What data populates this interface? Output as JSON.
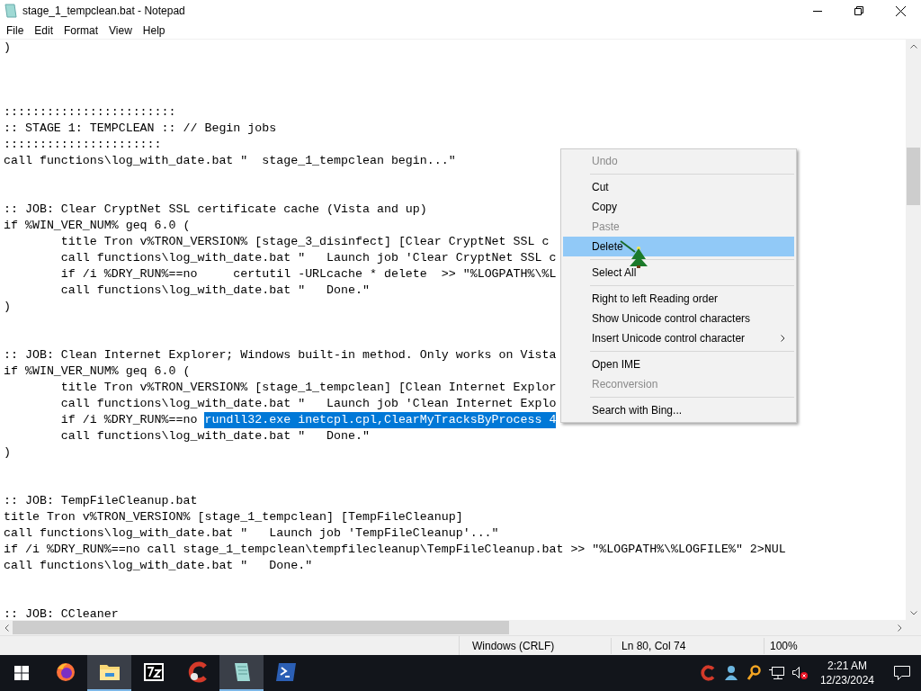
{
  "window": {
    "title": "stage_1_tempclean.bat - Notepad"
  },
  "menu_bar": [
    "File",
    "Edit",
    "Format",
    "View",
    "Help"
  ],
  "editor": {
    "lines": [
      {
        "kind": "code",
        "text": ")"
      },
      {
        "kind": "blank"
      },
      {
        "kind": "blank"
      },
      {
        "kind": "blank"
      },
      {
        "kind": "code",
        "text": "::::::::::::::::::::::::"
      },
      {
        "kind": "code",
        "text": ":: STAGE 1: TEMPCLEAN :: // Begin jobs"
      },
      {
        "kind": "code",
        "text": "::::::::::::::::::::::"
      },
      {
        "kind": "code",
        "text": "call functions\\log_with_date.bat \"  stage_1_tempclean begin...\""
      },
      {
        "kind": "blank"
      },
      {
        "kind": "blank"
      },
      {
        "kind": "code",
        "text": ":: JOB: Clear CryptNet SSL certificate cache (Vista and up)"
      },
      {
        "kind": "code",
        "text": "if %WIN_VER_NUM% geq 6.0 ("
      },
      {
        "kind": "code",
        "text": "\ttitle Tron v%TRON_VERSION% [stage_3_disinfect] [Clear CryptNet SSL c"
      },
      {
        "kind": "code",
        "text": "\tcall functions\\log_with_date.bat \"   Launch job 'Clear CryptNet SSL c"
      },
      {
        "kind": "code",
        "text": "\tif /i %DRY_RUN%==no     certutil -URLcache * delete  >> \"%LOGPATH%\\%L"
      },
      {
        "kind": "code",
        "text": "\tcall functions\\log_with_date.bat \"   Done.\""
      },
      {
        "kind": "code",
        "text": ")"
      },
      {
        "kind": "blank"
      },
      {
        "kind": "blank"
      },
      {
        "kind": "code",
        "text": ":: JOB: Clean Internet Explorer; Windows built-in method. Only works on Vista"
      },
      {
        "kind": "code",
        "text": "if %WIN_VER_NUM% geq 6.0 ("
      },
      {
        "kind": "code",
        "text": "\ttitle Tron v%TRON_VERSION% [stage_1_tempclean] [Clean Internet Explor"
      },
      {
        "kind": "code",
        "text": "\tcall functions\\log_with_date.bat \"   Launch job 'Clean Internet Explo"
      },
      {
        "kind": "code",
        "text": "\tif /i %DRY_RUN%==no ",
        "selected_text": "rundll32.exe inetcpl.cpl,ClearMyTracksByProcess 4"
      },
      {
        "kind": "code",
        "text": "\tcall functions\\log_with_date.bat \"   Done.\""
      },
      {
        "kind": "code",
        "text": ")"
      },
      {
        "kind": "blank"
      },
      {
        "kind": "blank"
      },
      {
        "kind": "code",
        "text": ":: JOB: TempFileCleanup.bat"
      },
      {
        "kind": "code",
        "text": "title Tron v%TRON_VERSION% [stage_1_tempclean] [TempFileCleanup]"
      },
      {
        "kind": "code",
        "text": "call functions\\log_with_date.bat \"   Launch job 'TempFileCleanup'...\""
      },
      {
        "kind": "code",
        "text": "if /i %DRY_RUN%==no call stage_1_tempclean\\tempfilecleanup\\TempFileCleanup.bat >> \"%LOGPATH%\\%LOGFILE%\" 2>NUL"
      },
      {
        "kind": "code",
        "text": "call functions\\log_with_date.bat \"   Done.\""
      },
      {
        "kind": "blank"
      },
      {
        "kind": "blank"
      },
      {
        "kind": "code",
        "text": ":: JOB: CCleaner"
      }
    ]
  },
  "context_menu": [
    {
      "kind": "item",
      "label": "Undo",
      "disabled": true,
      "selected": false
    },
    {
      "kind": "separator"
    },
    {
      "kind": "item",
      "label": "Cut",
      "disabled": false,
      "selected": false
    },
    {
      "kind": "item",
      "label": "Copy",
      "disabled": false,
      "selected": false
    },
    {
      "kind": "item",
      "label": "Paste",
      "disabled": true,
      "selected": false
    },
    {
      "kind": "item",
      "label": "Delete",
      "disabled": false,
      "selected": true
    },
    {
      "kind": "separator"
    },
    {
      "kind": "item",
      "label": "Select All",
      "disabled": false,
      "selected": false
    },
    {
      "kind": "separator"
    },
    {
      "kind": "item",
      "label": "Right to left Reading order",
      "disabled": false,
      "selected": false
    },
    {
      "kind": "item",
      "label": "Show Unicode control characters",
      "disabled": false,
      "selected": false
    },
    {
      "kind": "submenu",
      "label": "Insert Unicode control character",
      "disabled": false,
      "selected": false
    },
    {
      "kind": "separator"
    },
    {
      "kind": "item",
      "label": "Open IME",
      "disabled": false,
      "selected": false
    },
    {
      "kind": "item",
      "label": "Reconversion",
      "disabled": true,
      "selected": false
    },
    {
      "kind": "separator"
    },
    {
      "kind": "item",
      "label": "Search with Bing...",
      "disabled": false,
      "selected": false
    }
  ],
  "status_bar": {
    "line_ending": "Windows (CRLF)",
    "position": "Ln 80, Col 74",
    "zoom": "100%"
  },
  "taskbar": {
    "apps": [
      {
        "kind": "firefox",
        "active": false
      },
      {
        "kind": "folder",
        "active": true
      },
      {
        "kind": "archive",
        "active": false
      },
      {
        "kind": "cleaner",
        "active": false
      },
      {
        "kind": "notepad",
        "active": true
      },
      {
        "kind": "terminal",
        "active": false
      }
    ],
    "time": "2:21 AM",
    "date": "12/23/2024"
  }
}
